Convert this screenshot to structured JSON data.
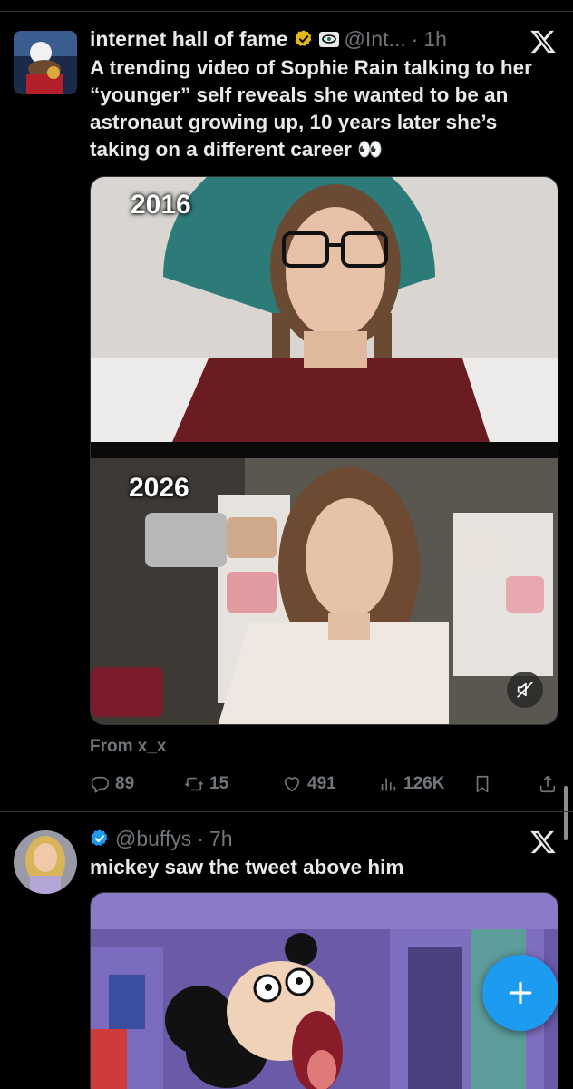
{
  "posts": [
    {
      "author_name": "internet hall of fame",
      "handle": "@Int...",
      "separator": "·",
      "time": "1h",
      "text": "A trending video of Sophie Rain talking to her “younger” self reveals she wanted to be an astronaut growing up, 10 years later she’s taking on a different career 👀",
      "media": {
        "label_top": "2016",
        "label_bottom": "2026"
      },
      "from_label": "From x_x",
      "stats": {
        "replies": "89",
        "reposts": "15",
        "likes": "491",
        "views": "126K"
      }
    },
    {
      "handle": "@buffys",
      "separator": "·",
      "time": "7h",
      "text": "mickey saw the tweet above him"
    }
  ],
  "icons": {
    "verified_gold": "verified-gold-icon",
    "verified_blue": "verified-blue-icon",
    "affiliate_badge": "affiliate-badge-icon",
    "x_logo": "x-logo-icon",
    "reply": "reply-icon",
    "repost": "repost-icon",
    "like": "heart-icon",
    "views": "views-icon",
    "bookmark": "bookmark-icon",
    "share": "share-icon",
    "mute": "muted-speaker-icon",
    "compose": "plus-icon"
  },
  "colors": {
    "background": "#000000",
    "text_primary": "#e7e9ea",
    "text_secondary": "#71767b",
    "divider": "#2f3336",
    "accent": "#1d9bf0",
    "verified_gold": "#e2b719"
  }
}
